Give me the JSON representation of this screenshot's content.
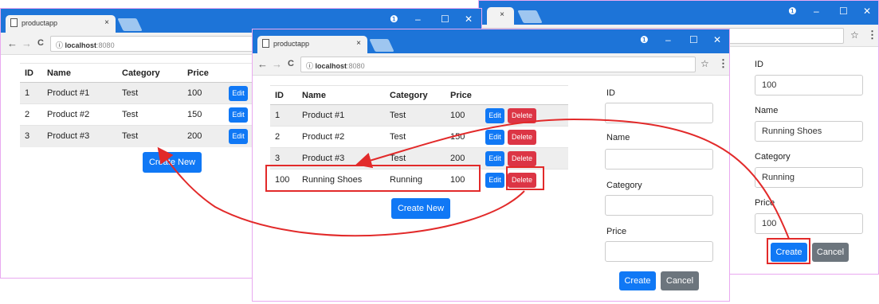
{
  "window_controls": {
    "account": "❶",
    "minimize": "–",
    "maximize": "☐",
    "close": "✕"
  },
  "browser": {
    "tab_title": "productapp",
    "tab_close": "×",
    "url_host": "localhost",
    "url_port": ":8080",
    "info_icon": "ⓘ",
    "star": "☆",
    "menu": "⋮",
    "back": "←",
    "forward": "→",
    "reload": "C"
  },
  "table": {
    "headers": [
      "ID",
      "Name",
      "Category",
      "Price"
    ],
    "rows_initial": [
      {
        "id": "1",
        "name": "Product #1",
        "category": "Test",
        "price": "100"
      },
      {
        "id": "2",
        "name": "Product #2",
        "category": "Test",
        "price": "150"
      },
      {
        "id": "3",
        "name": "Product #3",
        "category": "Test",
        "price": "200"
      }
    ],
    "new_row": {
      "id": "100",
      "name": "Running Shoes",
      "category": "Running",
      "price": "100"
    },
    "edit_label": "Edit",
    "delete_label": "Delete"
  },
  "create_new_label": "Create New",
  "form": {
    "id_label": "ID",
    "name_label": "Name",
    "category_label": "Category",
    "price_label": "Price",
    "create_label": "Create",
    "cancel_label": "Cancel",
    "filled": {
      "id": "100",
      "name": "Running Shoes",
      "category": "Running",
      "price": "100"
    }
  },
  "colors": {
    "titlebar": "#1d74d8",
    "primary": "#1078f5",
    "danger": "#dc3545",
    "secondary": "#6c757d",
    "highlight": "#e22a2a"
  }
}
